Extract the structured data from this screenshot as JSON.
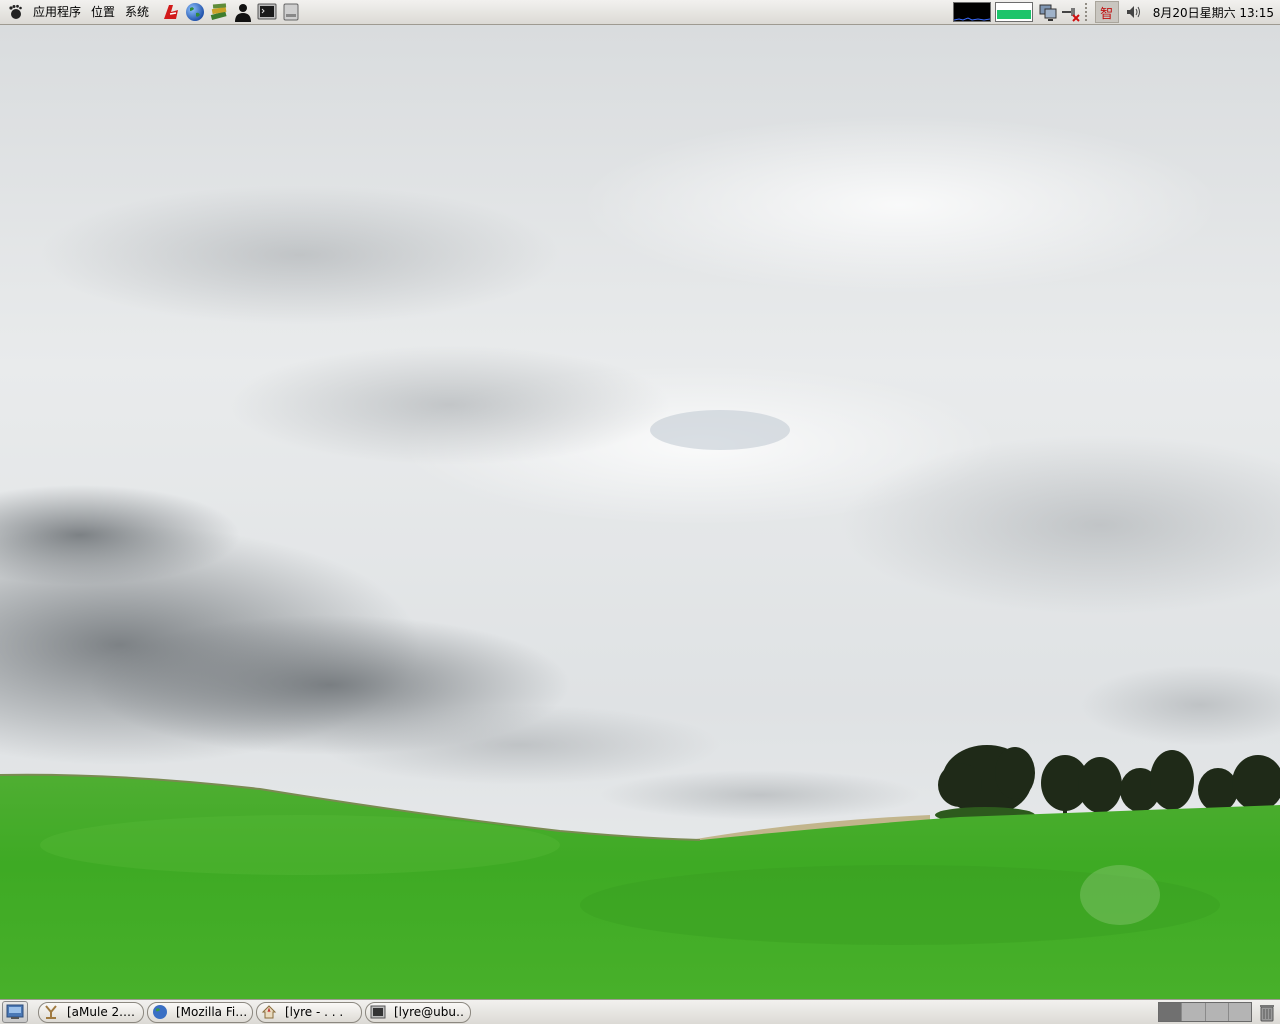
{
  "top_panel": {
    "menus": {
      "applications": "应用程序",
      "places": "位置",
      "system": "系统"
    },
    "launchers": [
      {
        "icon": "pdf-reader-icon"
      },
      {
        "icon": "firefox-globe-icon"
      },
      {
        "icon": "dictionary-books-icon"
      },
      {
        "icon": "user-icon"
      },
      {
        "icon": "terminal-icon"
      },
      {
        "icon": "file-manager-icon"
      }
    ],
    "tray": {
      "ime_label": "智",
      "clock": "8月20日星期六 13:15"
    }
  },
  "taskbar": {
    "tasks": [
      {
        "label": "[aMule 2.…",
        "icon": "amule-icon"
      },
      {
        "label": "[Mozilla Fi…",
        "icon": "firefox-icon"
      },
      {
        "label": "[lyre - . . .",
        "icon": "home-folder-icon"
      },
      {
        "label": "[lyre@ubu…",
        "icon": "terminal-icon"
      }
    ],
    "workspaces": 4,
    "active_workspace": 1
  },
  "colors": {
    "panel_top": "#f2f1ef",
    "panel_bottom": "#dcdad5",
    "grass": "#3fae2a",
    "sky": "#e4e6e7"
  }
}
